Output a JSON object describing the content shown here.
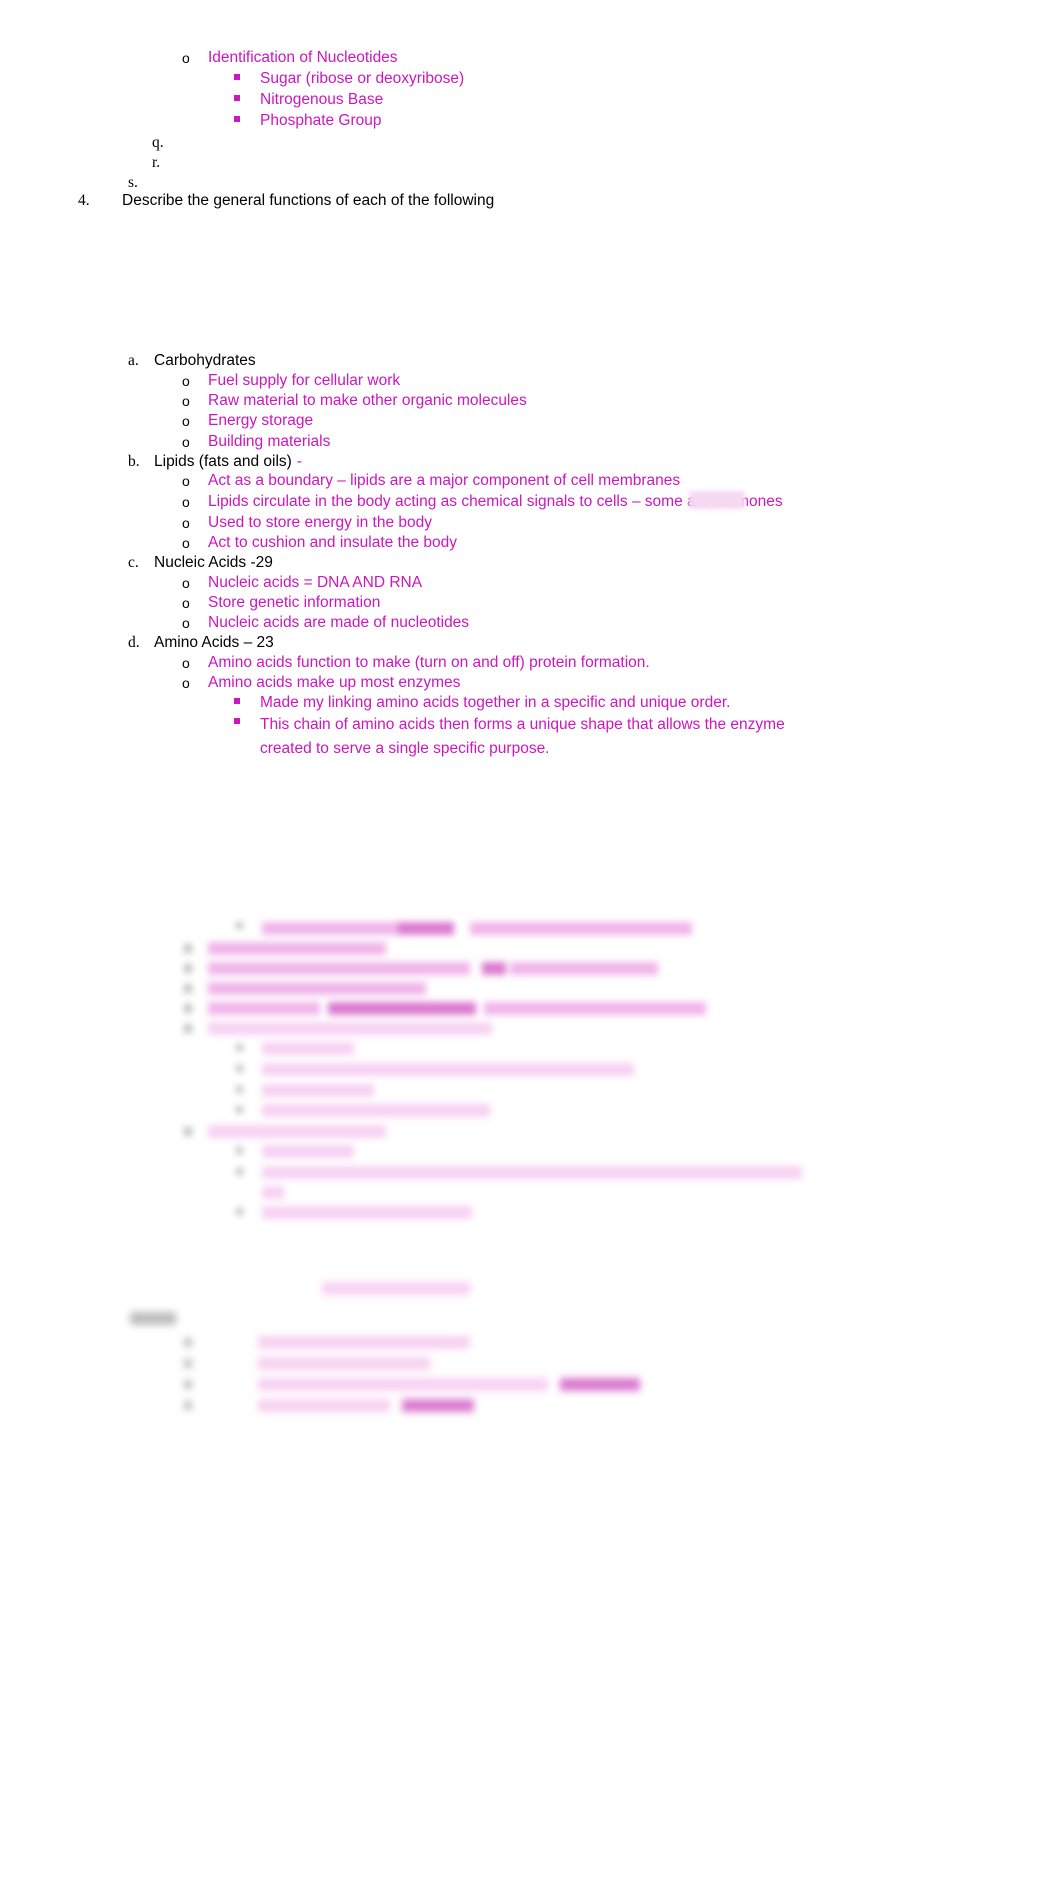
{
  "document": {
    "text_color_magenta": "#CC16BE",
    "text_color_black": "#000000",
    "background": "#ffffff"
  },
  "outline": {
    "nucleotides": {
      "marker": "o",
      "label": "Identification of Nucleotides",
      "children": [
        {
          "marker": "square",
          "label": "Sugar (ribose or deoxyribose)"
        },
        {
          "marker": "square",
          "label": "Nitrogenous Base"
        },
        {
          "marker": "square",
          "label": "Phosphate Group"
        }
      ]
    },
    "empty_items": [
      {
        "marker": "q."
      },
      {
        "marker": "r."
      },
      {
        "marker": "s."
      }
    ],
    "question_4": {
      "marker": "4.",
      "label": "Describe the general functions of each of the following"
    },
    "sections": [
      {
        "marker": "a.",
        "title": "Carbohydrates",
        "title_suffix": "",
        "bullets": [
          "Fuel supply for cellular work",
          "Raw material to make other organic molecules",
          "Energy storage",
          "Building materials"
        ]
      },
      {
        "marker": "b.",
        "title": "Lipids (fats and oils)",
        "title_suffix": "-",
        "bullets": [
          "Act as a boundary – lipids are a major component of cell membranes",
          "Lipids circulate in the body acting as chemical signals to cells – some are hormones",
          "Used to store energy in the body",
          "Act to cushion and insulate the body"
        ]
      },
      {
        "marker": "c.",
        "title": "Nucleic Acids -29",
        "title_suffix": "",
        "bullets": [
          "Nucleic acids = DNA AND RNA",
          "Store genetic information",
          "Nucleic acids are made of nucleotides"
        ]
      },
      {
        "marker": "d.",
        "title": "Amino Acids – 23",
        "title_suffix": "",
        "bullets": [
          "Amino acids function to make (turn on and off) protein formation.",
          "Amino acids make up most enzymes"
        ],
        "sub_bullets": [
          "Made my linking amino acids together in a specific and unique order.",
          "This chain of amino acids then forms a unique shape that allows the enzyme created to serve a single specific purpose."
        ]
      }
    ],
    "redacted_note": "Remaining outline content below is blurred and illegible in the source image."
  }
}
